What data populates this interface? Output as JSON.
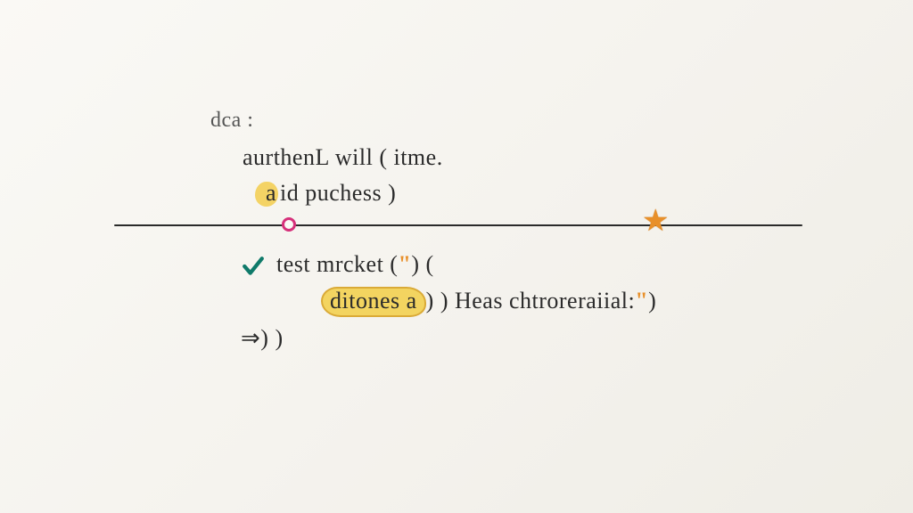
{
  "line1": "dca :",
  "line2": "aurthenL will ( itme.",
  "line3_a": "a",
  "line3_b": "id puchess )",
  "line4_pre": "test mrcket (",
  "line4_quote1": "\"",
  "line4_post": ") (",
  "line5_hl": "ditones a",
  "line5_mid": ") ) Heas chtroreraiial:",
  "line5_quote2": "\"",
  "line5_end": ")",
  "line6": "⇒) )",
  "icons": {
    "checkmark": "checkmark-icon",
    "star": "star-icon",
    "circle_marker": "circle-marker-icon",
    "highlight1": "highlight-blob-icon",
    "highlight2": "highlight-pill-icon"
  },
  "colors": {
    "ink": "#2b2b2b",
    "accent_orange": "#e8902a",
    "accent_magenta": "#d6307a",
    "accent_teal": "#0f7a6a",
    "highlight_yellow": "#f3d255"
  }
}
